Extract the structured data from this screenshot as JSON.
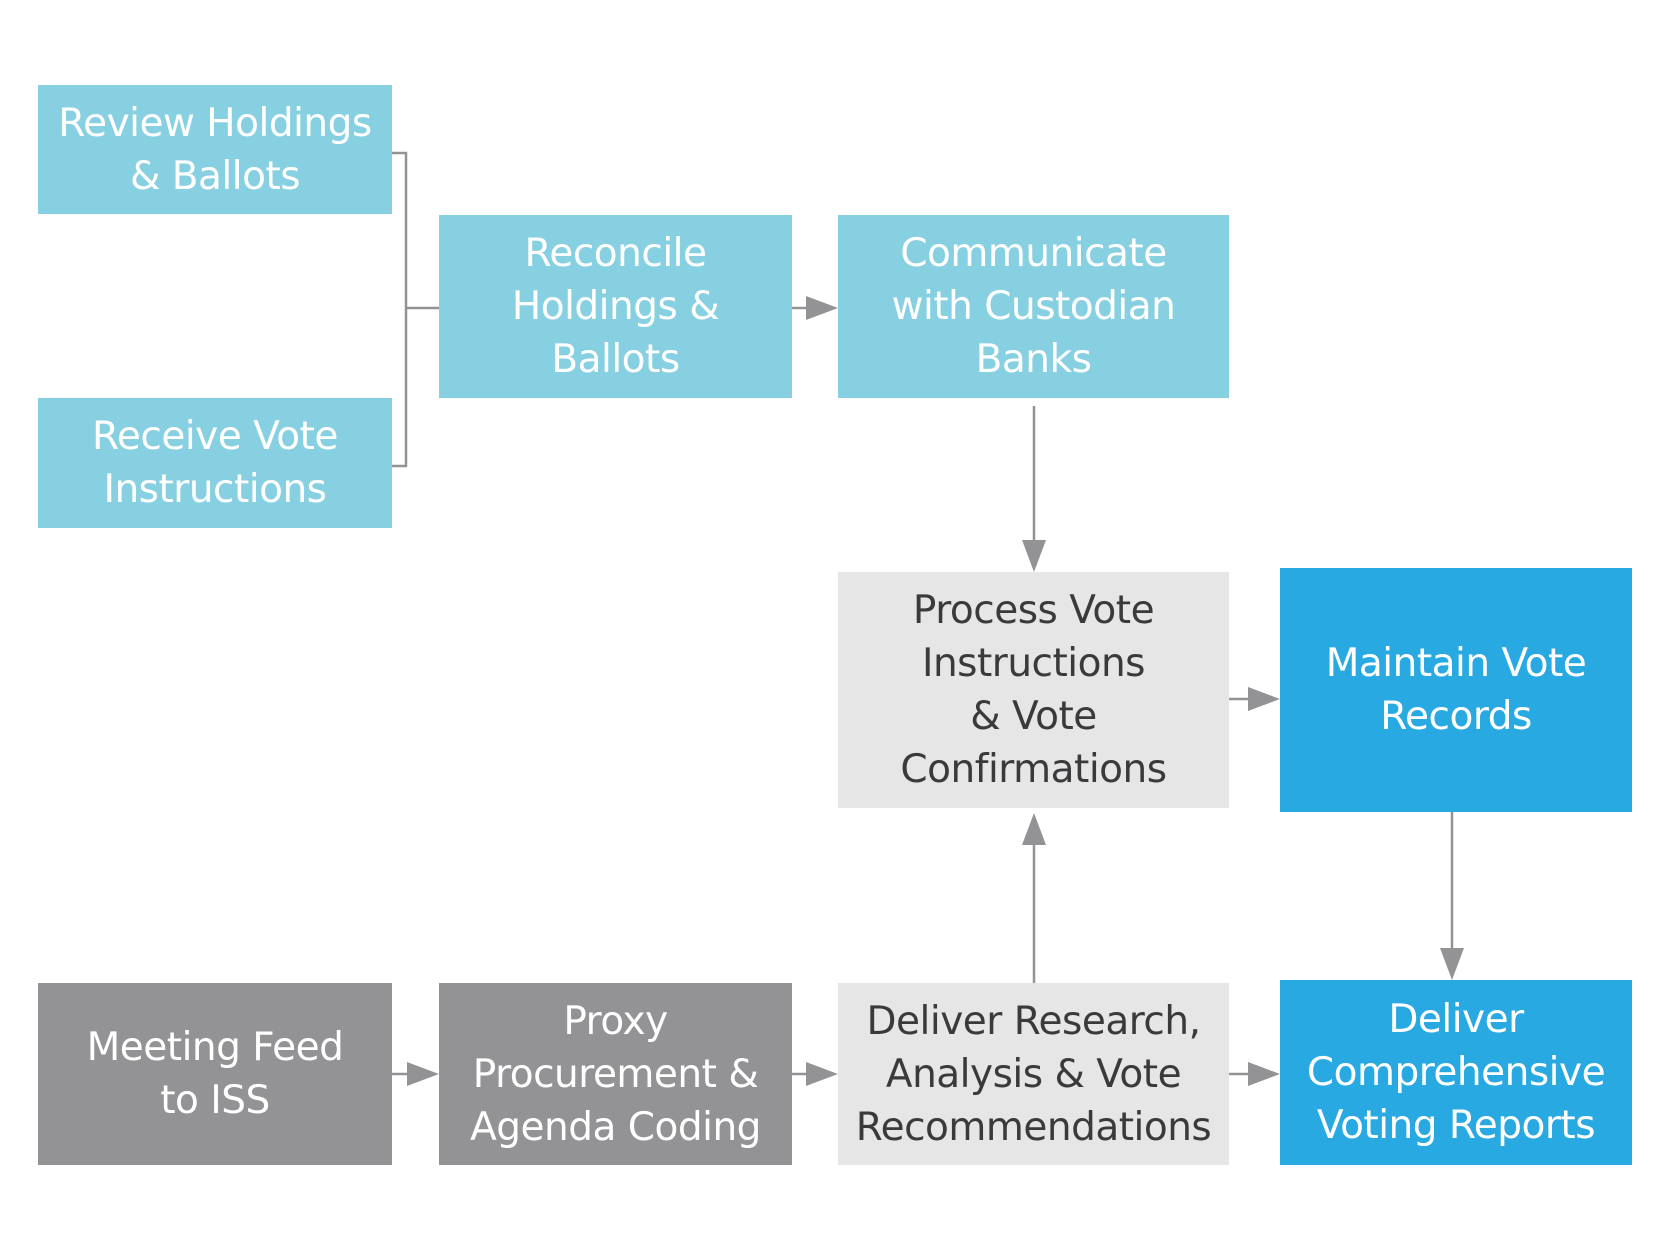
{
  "diagram": {
    "type": "flowchart",
    "colors": {
      "light_teal": "#87d0e2",
      "light_grey": "#e6e6e7",
      "dark_grey": "#939396",
      "bright_blue": "#29a9e1",
      "connector": "#939396"
    },
    "nodes": {
      "review_holdings": "Review Holdings\n& Ballots",
      "receive_vote": "Receive Vote\nInstructions",
      "reconcile": "Reconcile\nHoldings &\nBallots",
      "communicate": "Communicate\nwith Custodian\nBanks",
      "process_vote": "Process Vote\nInstructions\n& Vote\nConfirmations",
      "maintain_records": "Maintain Vote\nRecords",
      "meeting_feed": "Meeting Feed\nto ISS",
      "proxy_procurement": "Proxy\nProcurement &\nAgenda Coding",
      "deliver_research": "Deliver Research,\nAnalysis & Vote\nRecommendations",
      "deliver_reports": "Deliver\nComprehensive\nVoting Reports"
    },
    "edges": [
      {
        "from": "review_holdings",
        "to": "reconcile",
        "style": "bracket"
      },
      {
        "from": "receive_vote",
        "to": "reconcile",
        "style": "bracket"
      },
      {
        "from": "reconcile",
        "to": "communicate",
        "style": "arrow"
      },
      {
        "from": "communicate",
        "to": "process_vote",
        "style": "arrow"
      },
      {
        "from": "process_vote",
        "to": "maintain_records",
        "style": "arrow"
      },
      {
        "from": "maintain_records",
        "to": "deliver_reports",
        "style": "arrow"
      },
      {
        "from": "meeting_feed",
        "to": "proxy_procurement",
        "style": "arrow"
      },
      {
        "from": "proxy_procurement",
        "to": "deliver_research",
        "style": "arrow"
      },
      {
        "from": "deliver_research",
        "to": "process_vote",
        "style": "arrow"
      },
      {
        "from": "deliver_research",
        "to": "deliver_reports",
        "style": "arrow"
      }
    ]
  }
}
